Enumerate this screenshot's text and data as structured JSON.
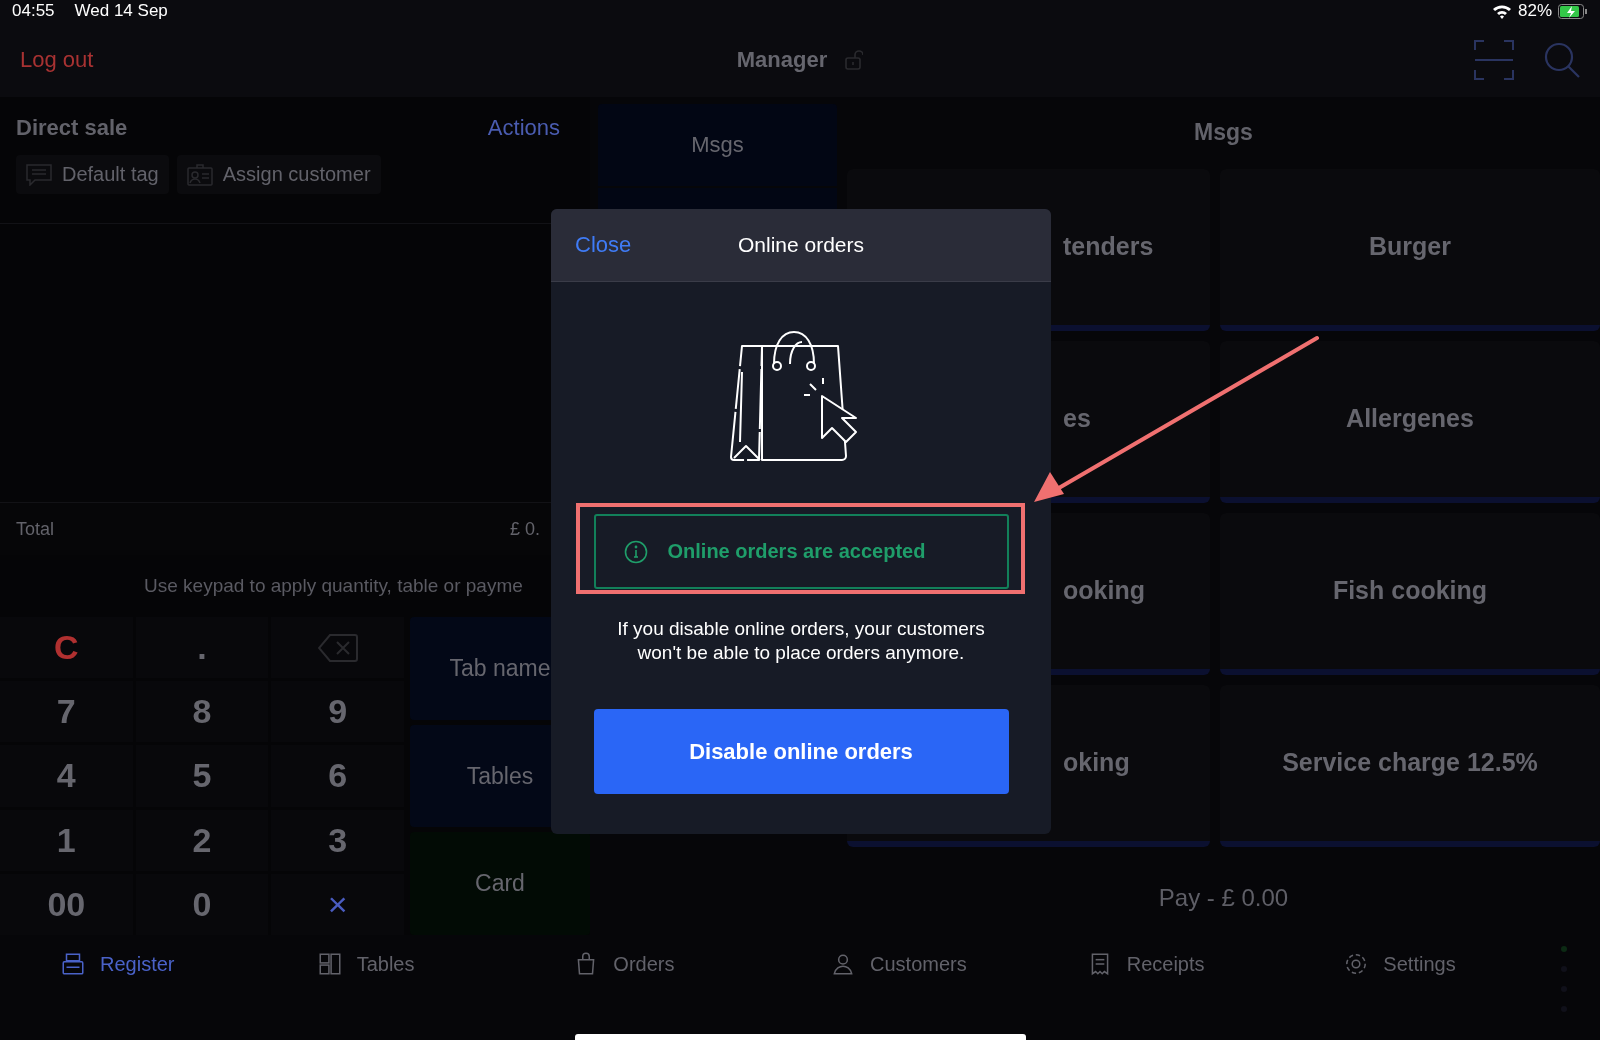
{
  "status_bar": {
    "time": "04:55",
    "date": "Wed 14 Sep",
    "battery": "82%"
  },
  "header": {
    "logout": "Log out",
    "user": "Manager"
  },
  "sale": {
    "title": "Direct sale",
    "actions": "Actions",
    "tags": [
      {
        "label": "Default tag",
        "kind": "tag"
      },
      {
        "label": "Assign customer",
        "kind": "customer"
      }
    ],
    "total_label": "Total",
    "total_value": "£ 0.",
    "hint": "Use keypad to apply quantity, table or payme"
  },
  "keypad": [
    {
      "label": "C",
      "kind": "clear"
    },
    {
      "label": ".",
      "kind": "digit"
    },
    {
      "kind": "backspace"
    },
    {
      "label": "7",
      "kind": "digit"
    },
    {
      "label": "8",
      "kind": "digit"
    },
    {
      "label": "9",
      "kind": "digit"
    },
    {
      "label": "4",
      "kind": "digit"
    },
    {
      "label": "5",
      "kind": "digit"
    },
    {
      "label": "6",
      "kind": "digit"
    },
    {
      "label": "1",
      "kind": "digit"
    },
    {
      "label": "2",
      "kind": "digit"
    },
    {
      "label": "3",
      "kind": "digit"
    },
    {
      "label": "00",
      "kind": "digit"
    },
    {
      "label": "0",
      "kind": "digit"
    },
    {
      "label": "×",
      "kind": "cancel"
    }
  ],
  "pay_actions": [
    {
      "label": "Tab name",
      "kind": "tab"
    },
    {
      "label": "Tables",
      "kind": "tables"
    },
    {
      "label": "Card",
      "kind": "card"
    }
  ],
  "msgs_column": {
    "title": "Msgs"
  },
  "grid": {
    "title": "Msgs",
    "tiles": [
      "tenders",
      "Burger",
      "es",
      "Allergenes",
      "ooking",
      "Fish cooking",
      "oking",
      "Service charge 12.5%"
    ],
    "pay": "Pay - £ 0.00"
  },
  "bottom_nav": [
    {
      "label": "Register",
      "selected": true,
      "kind": "register"
    },
    {
      "label": "Tables",
      "selected": false,
      "kind": "tables"
    },
    {
      "label": "Orders",
      "selected": false,
      "kind": "orders"
    },
    {
      "label": "Customers",
      "selected": false,
      "kind": "customers"
    },
    {
      "label": "Receipts",
      "selected": false,
      "kind": "receipts"
    },
    {
      "label": "Settings",
      "selected": false,
      "kind": "settings"
    }
  ],
  "modal": {
    "close": "Close",
    "title": "Online orders",
    "notice": "Online orders are accepted",
    "message": "If you disable online orders, your customers won't be able to place orders anymore.",
    "button": "Disable online orders"
  }
}
